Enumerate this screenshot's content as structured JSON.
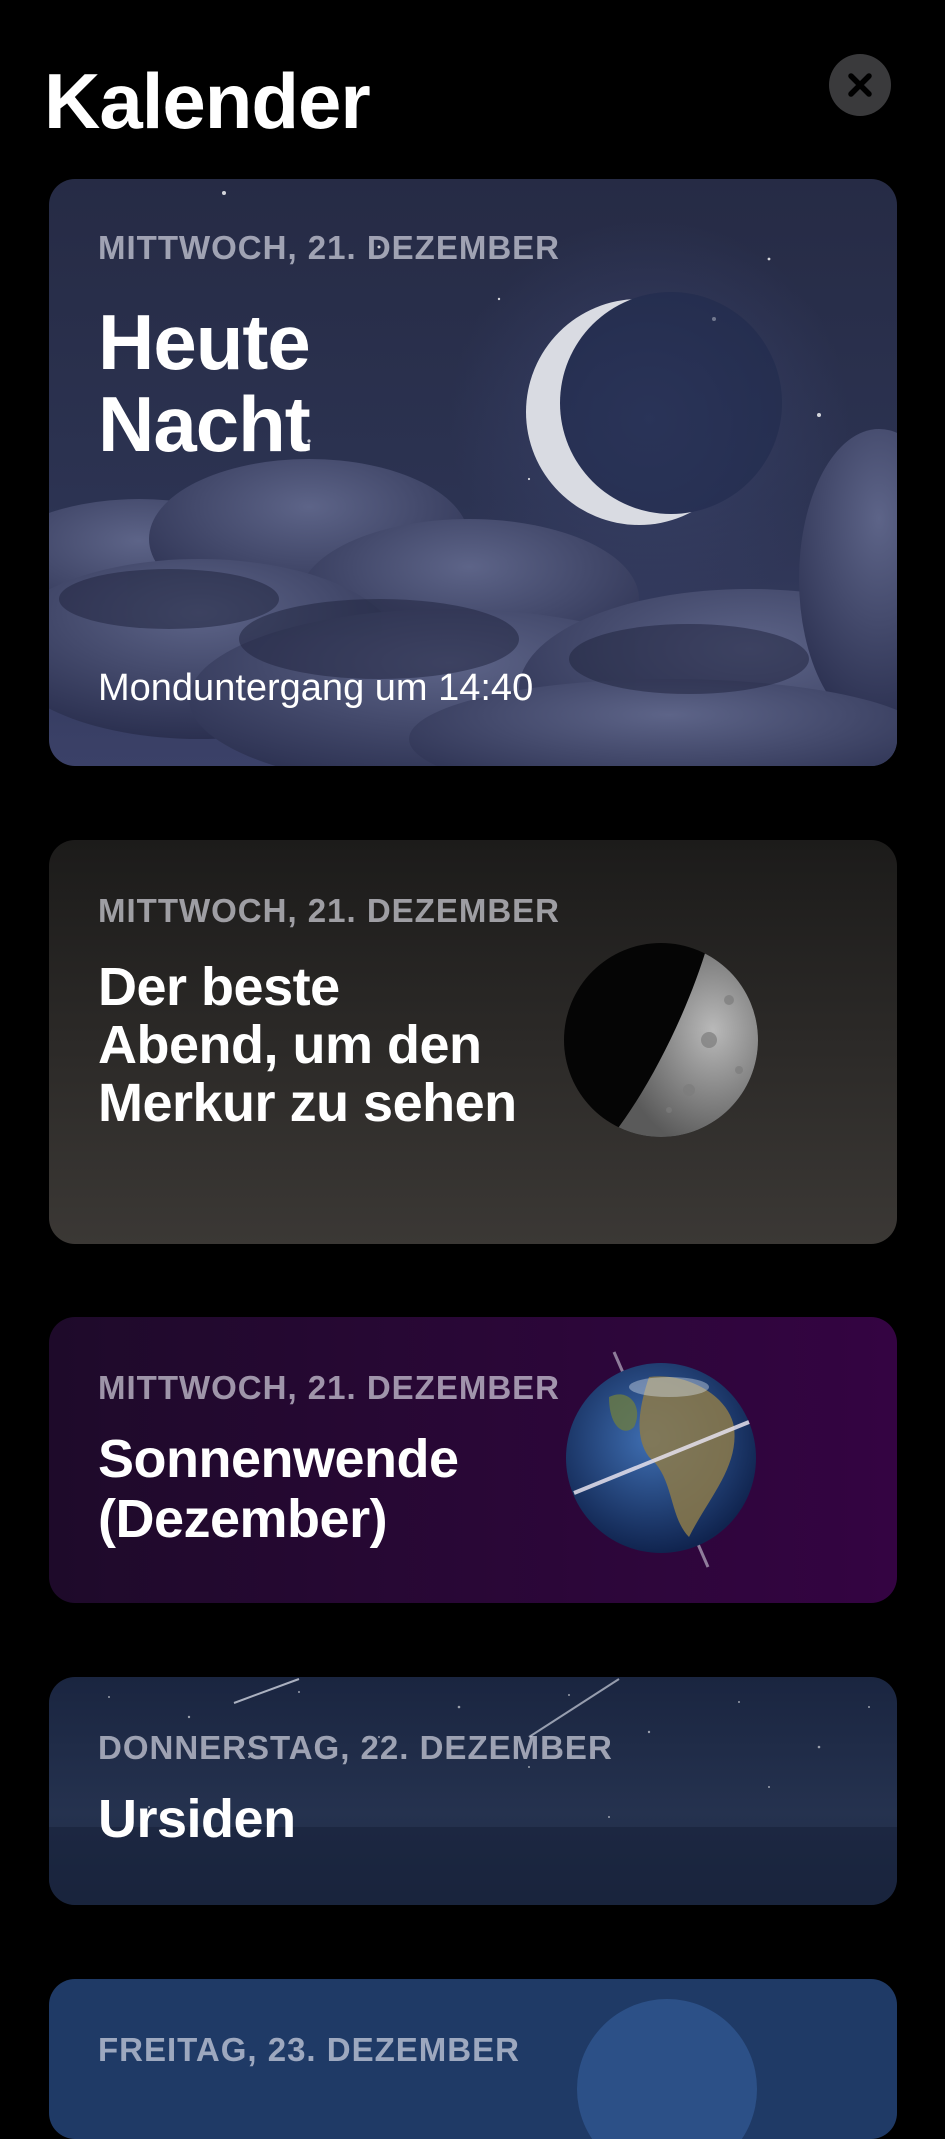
{
  "header": {
    "title": "Kalender",
    "close_icon": "close-icon"
  },
  "cards": [
    {
      "date": "MITTWOCH, 21. DEZEMBER",
      "title": "Heute Nacht",
      "subline": "Monduntergang um 14:40",
      "art": "crescent-moon-over-clouds"
    },
    {
      "date": "MITTWOCH, 21. DEZEMBER",
      "title": "Der beste Abend, um den Merkur zu sehen",
      "art": "mercury-planet"
    },
    {
      "date": "MITTWOCH, 21. DEZEMBER",
      "title": "Sonnenwende (Dezember)",
      "art": "earth-globe-with-equator"
    },
    {
      "date": "DONNERSTAG, 22. DEZEMBER",
      "title": "Ursiden",
      "art": "meteor-shower-starfield"
    },
    {
      "date": "FREITAG, 23. DEZEMBER",
      "art": "planet-partial"
    }
  ],
  "colors": {
    "background": "#000000",
    "card_tonight": "#2a3050",
    "card_mercury": "#2a2826",
    "card_solstice": "#2b0a3d",
    "card_ursids": "#1e2a44",
    "card_friday": "#1f3a66"
  }
}
